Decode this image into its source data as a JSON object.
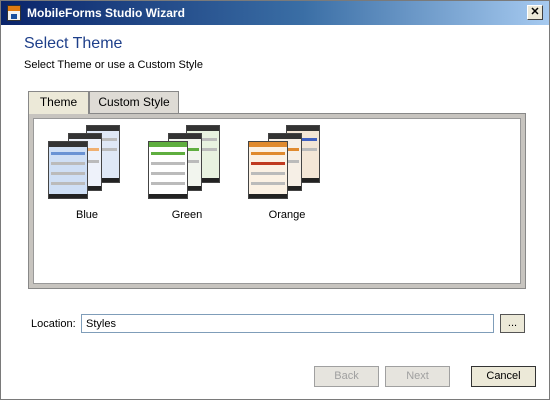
{
  "window": {
    "title": "MobileForms Studio Wizard"
  },
  "heading": "Select Theme",
  "subheading": "Select Theme or use a Custom Style",
  "tabs": [
    {
      "label": "Theme",
      "selected": true
    },
    {
      "label": "Custom Style",
      "selected": false
    }
  ],
  "themes": [
    {
      "label": "Blue",
      "accent": "#6a93d4"
    },
    {
      "label": "Green",
      "accent": "#5fae3f"
    },
    {
      "label": "Orange",
      "accent": "#e08a2e"
    }
  ],
  "location": {
    "label": "Location:",
    "value": "Styles",
    "browse_label": "..."
  },
  "buttons": {
    "back": "Back",
    "next": "Next",
    "cancel": "Cancel"
  },
  "colors": {
    "title_gradient_start": "#0a246a",
    "heading": "#1e3f8a"
  },
  "icons": {
    "close": "close-icon",
    "app": "app-icon"
  }
}
